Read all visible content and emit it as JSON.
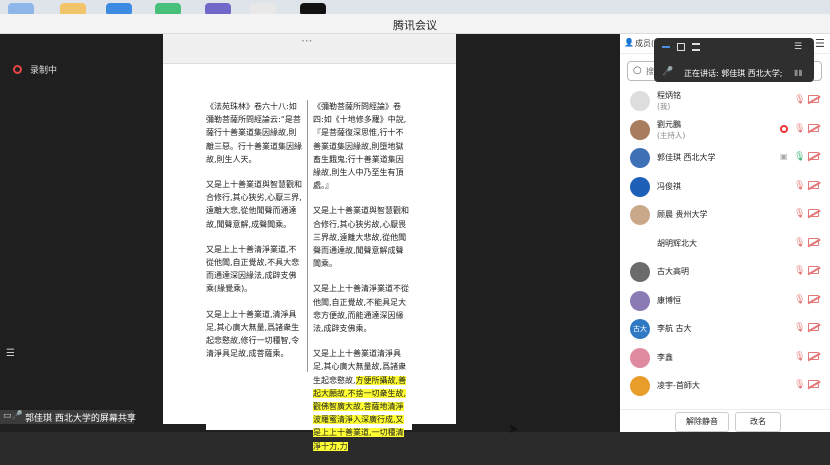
{
  "window": {
    "title": "腾讯会议"
  },
  "recording": {
    "label": "录制中"
  },
  "sharing": {
    "label": "郭佳琪 西北大学的屏幕共享"
  },
  "speaking": {
    "label": "正在讲话: 郭佳琪 西北大学;"
  },
  "panel": {
    "header": "成员(",
    "search_placeholder": "搜索成员",
    "members": [
      {
        "name": "程炳铭",
        "sub": "(我)",
        "avatar_color": "#ddd"
      },
      {
        "name": "劉元鵬",
        "sub": "(主持人)",
        "avatar_color": "#a97b5f",
        "recording": true
      },
      {
        "name": "郭佳琪 西北大学",
        "avatar_color": "#3f6fb5",
        "sharing": true,
        "mic_on": true
      },
      {
        "name": "冯俊祺",
        "avatar_color": "#1e5fb8"
      },
      {
        "name": "顾晨 贵州大学",
        "avatar_color": "#c9a88a"
      },
      {
        "name": "胡明辉北大",
        "avatar_color": "#ffffff"
      },
      {
        "name": "古大高明",
        "avatar_color": "#6b6b6b"
      },
      {
        "name": "康博恒",
        "avatar_color": "#8a7bb5"
      },
      {
        "name": "李航 古大",
        "avatar_text": "古大",
        "avatar_color": "#2f78c4"
      },
      {
        "name": "李鑫",
        "avatar_color": "#e08aa0"
      },
      {
        "name": "凌宇-首師大",
        "avatar_color": "#e89c2a"
      }
    ],
    "unmute_all": "解除静音",
    "rename": "改名"
  },
  "document": {
    "col1": [
      "《法苑珠林》卷六十八:如彌勒菩薩所問經論云:“是菩薩行十善業道集因緣故,則離三惡。行十善業道集因緣故,則生人天。",
      "又是上十善業道與智慧觀和合修行,其心狹劣,心厭三界,遠離大悲,從他聞聲而通達故,聞聲意解,成聲聞乘。",
      "又是上上十善清淨業道,不從他聞,自正覺故,不具大悲而通達深因緣法,成辟支佛乘(緣覺乘)。",
      "又是上上十善業道,清淨具足,其心廣大無量,爲諸衆生起悲愍故,修行一切種智,令清淨具足故,成菩薩乘。"
    ],
    "col2": [
      "《彌勒菩薩所問經論》卷四:如《十地修多羅》中說,『是菩薩復深思惟,行十不善業道集因緣故,則墮地獄畜生餓鬼;行十善業道集因緣故,則生人中乃至生有頂處。』",
      "又是上十善業道與智慧觀和合修行,其心狹劣故,心厭畏三界故,遠離大悲故,從他聞聲而通達故,聞聲意解成聲聞乘。",
      "又是上上十善清淨業道不從他聞,自正覺故,不能具足大悲方便故,而能通達深因緣法,成辟支佛乘。",
      "又是上上十善業道清淨具足,其心廣大無量故,爲諸衆生起悲愍故,"
    ],
    "col2_highlight": "方便所攝故,善起大願故,不捨一切衆生故,觀佛智廣大故,菩薩地清淨波羅蜜清淨入深廣行成,又是上上十善業道,一切種清淨十力,力"
  }
}
